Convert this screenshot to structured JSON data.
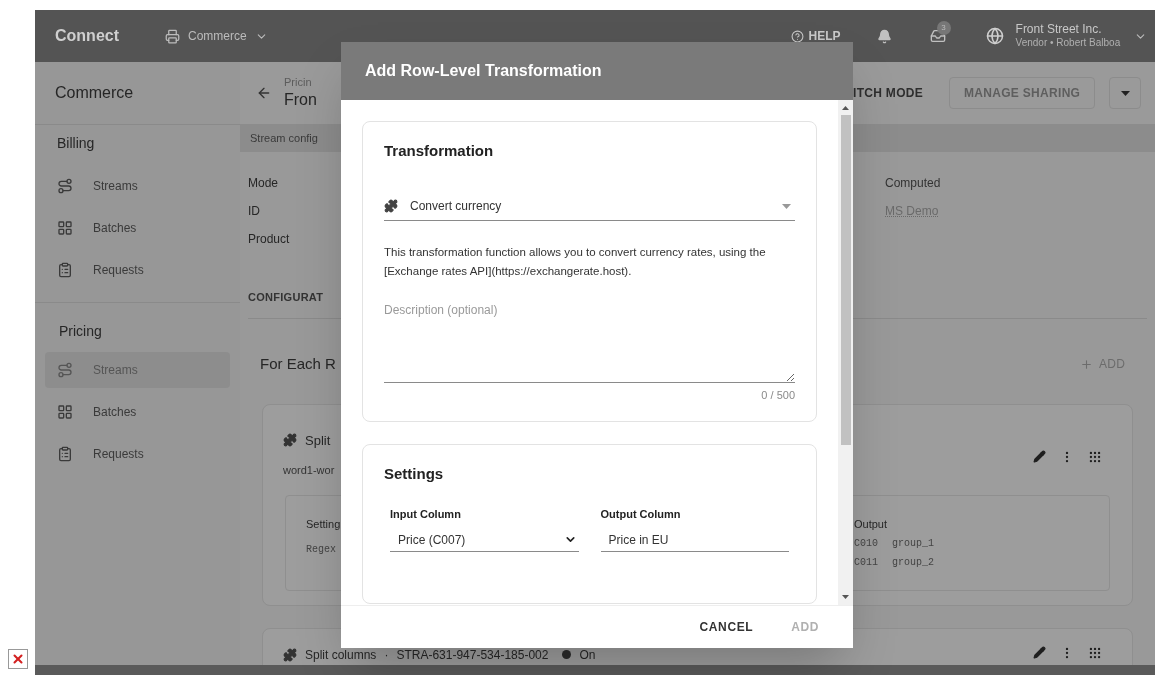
{
  "topbar": {
    "logo": "Connect",
    "workspace": "Commerce",
    "help": "HELP",
    "inbox_badge": "3",
    "account": {
      "name": "Front Street Inc.",
      "subtitle": "Vendor • Robert Balboa"
    }
  },
  "sidebar": {
    "title": "Commerce",
    "sections": [
      {
        "label": "Billing",
        "items": [
          {
            "label": "Streams",
            "kind": "streams",
            "selected": false
          },
          {
            "label": "Batches",
            "kind": "batches",
            "selected": false
          },
          {
            "label": "Requests",
            "kind": "requests",
            "selected": false
          }
        ]
      },
      {
        "label": "Pricing",
        "items": [
          {
            "label": "Streams",
            "kind": "streams",
            "selected": true
          },
          {
            "label": "Batches",
            "kind": "batches",
            "selected": false
          },
          {
            "label": "Requests",
            "kind": "requests",
            "selected": false
          }
        ]
      }
    ]
  },
  "page": {
    "breadcrumb": "Pricin",
    "title": "Fron",
    "buttons": [
      {
        "label": "ITCH MODE",
        "disabled": false
      },
      {
        "label": "MANAGE SHARING",
        "disabled": true
      }
    ],
    "tab": "Stream config",
    "details": [
      "Mode",
      "ID",
      "Product"
    ],
    "values": [
      {
        "text": "Computed",
        "kind": "plain"
      },
      {
        "text": "MS Demo",
        "kind": "link"
      }
    ],
    "section": "CONFIGURAT",
    "for_each": "For Each R",
    "add": "ADD",
    "cards": [
      {
        "title": "Split",
        "subtitle": "word1-wor",
        "settings_label": "Setting",
        "settings_value": "Regex",
        "output_label": "Output",
        "outputs": [
          {
            "column": "C010",
            "name": "group_1"
          },
          {
            "column": "C011",
            "name": "group_2"
          }
        ]
      },
      {
        "title": "Split columns",
        "separator": "·",
        "id": "STRA-631-947-534-185-002",
        "status": "On",
        "color": "#2b2b2b"
      }
    ]
  },
  "dialog": {
    "title": "Add Row-Level Transformation",
    "transformation": {
      "heading": "Transformation",
      "function": "Convert currency",
      "description": "This transformation function allows you to convert currency rates, using the [Exchange rates API](https://exchangerate.host).",
      "placeholder": "Description (optional)",
      "counter": "0 / 500"
    },
    "settings": {
      "heading": "Settings",
      "input_label": "Input Column",
      "input_value": "Price (C007)",
      "output_label": "Output Column",
      "output_value": "Price in EU"
    },
    "buttons": [
      {
        "label": "CANCEL",
        "disabled": false
      },
      {
        "label": "ADD",
        "disabled": true
      }
    ]
  }
}
